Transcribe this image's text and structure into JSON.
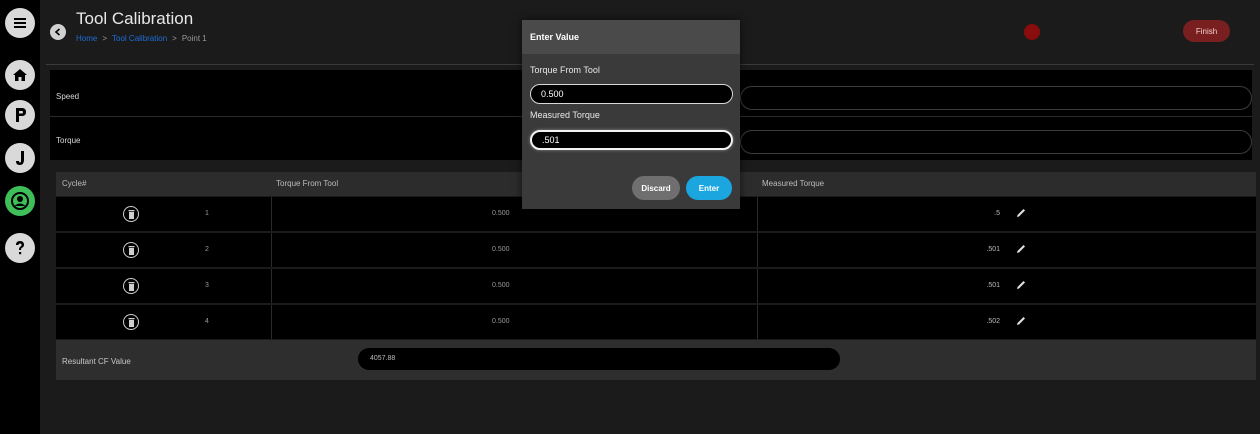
{
  "nav": {
    "items": [
      {
        "name": "menu-icon"
      },
      {
        "name": "home-icon"
      },
      {
        "name": "letter-p-icon"
      },
      {
        "name": "letter-j-icon"
      },
      {
        "name": "user-icon"
      },
      {
        "name": "help-icon"
      }
    ]
  },
  "header": {
    "title": "Tool Calibration",
    "breadcrumb": [
      "Home",
      "Tool Calibration",
      "Point 1"
    ],
    "breadcrumb_separator": ">",
    "finish_label": "Finish",
    "status_color": "#8a0d0d"
  },
  "params": {
    "speed_label": "Speed",
    "torque_label": "Torque"
  },
  "table": {
    "headers": [
      "Cycle#",
      "Torque From Tool",
      "Measured Torque"
    ],
    "rows": [
      {
        "cycle": "1",
        "torque_from_tool": "0.500",
        "measured": ".5"
      },
      {
        "cycle": "2",
        "torque_from_tool": "0.500",
        "measured": ".501"
      },
      {
        "cycle": "3",
        "torque_from_tool": "0.500",
        "measured": ".501"
      },
      {
        "cycle": "4",
        "torque_from_tool": "0.500",
        "measured": ".502"
      }
    ]
  },
  "result": {
    "label": "Resultant CF Value",
    "value": "4057.88"
  },
  "modal": {
    "title": "Enter Value",
    "torque_from_tool_label": "Torque From Tool",
    "torque_from_tool_value": "0.500",
    "measured_torque_label": "Measured Torque",
    "measured_torque_value": ".501",
    "discard_label": "Discard",
    "enter_label": "Enter"
  },
  "colors": {
    "accent": "#1ba6df",
    "finish": "#7a1f1f",
    "profile_active": "#3fbf5a"
  }
}
